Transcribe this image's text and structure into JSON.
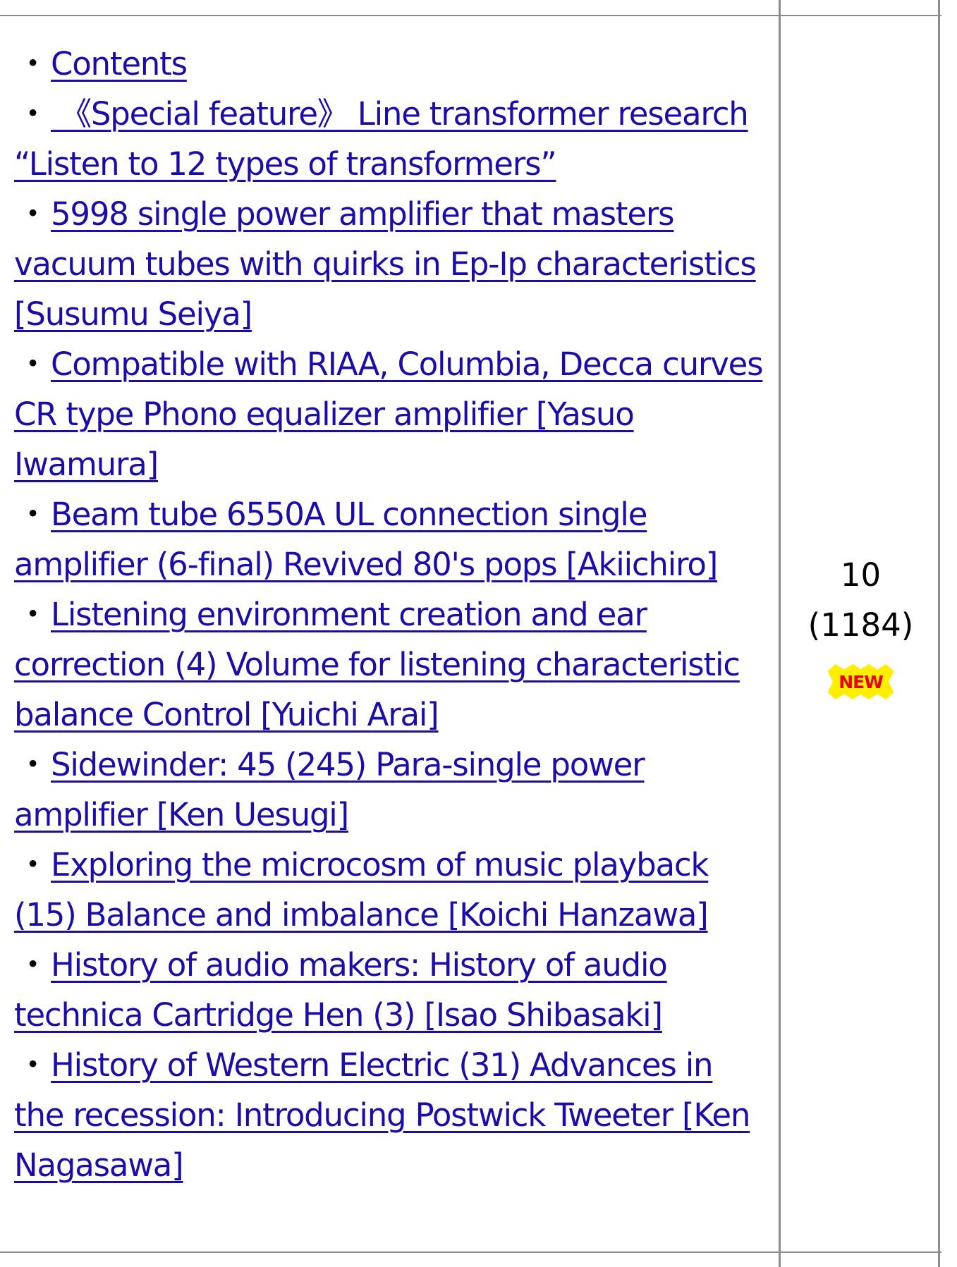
{
  "contents": {
    "bullet": "・",
    "items": [
      "Contents",
      " 《Special feature》 Line transformer research “Listen to 12 types of transformers”",
      "5998 single power amplifier that masters vacuum tubes with quirks in Ep-Ip characteristics [Susumu Seiya]",
      "Compatible with RIAA, Columbia, Decca curves CR type Phono equalizer amplifier [Yasuo Iwamura]",
      "Beam tube 6550A UL connection single amplifier (6-final) Revived 80's pops [Akiichiro]",
      "Listening environment creation and ear correction (4) Volume for listening characteristic balance Control [Yuichi Arai]",
      "Sidewinder: 45 (245) Para-single power amplifier [Ken Uesugi]",
      "Exploring the microcosm of music playback (15) Balance and imbalance [Koichi Hanzawa]",
      "History of audio makers: History of audio technica Cartridge Hen (3) [Isao Shibasaki]",
      "History of Western Electric (31) Advances in the recession: Introducing Postwick Tweeter [Ken Nagasawa]"
    ]
  },
  "issue": {
    "number": "10",
    "total": "(1184)",
    "badge": "NEW"
  },
  "colors": {
    "link": "#1a0dab",
    "grid": "#8c8c8c",
    "badge_bg": "#ffee00",
    "badge_text": "#e60012"
  }
}
